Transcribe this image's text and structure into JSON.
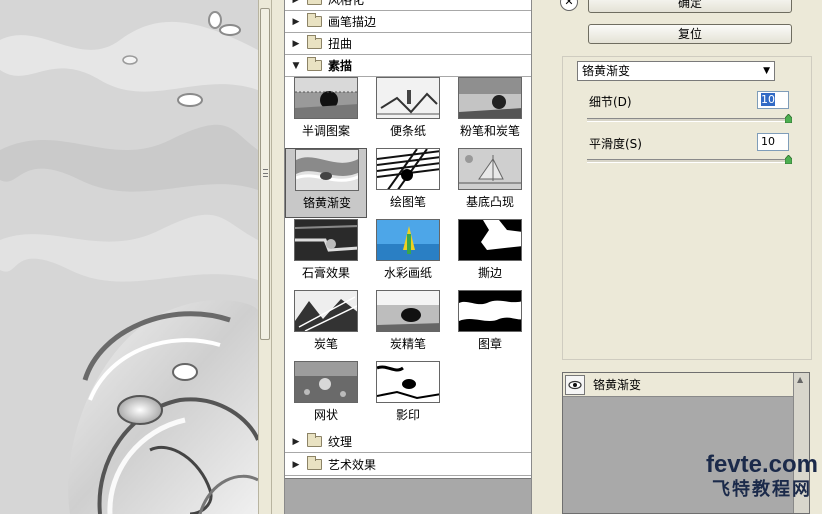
{
  "gallery": {
    "categories_top": [
      {
        "label": "风格化",
        "state": "collapsed"
      },
      {
        "label": "画笔描边",
        "state": "collapsed"
      },
      {
        "label": "扭曲",
        "state": "collapsed"
      },
      {
        "label": "素描",
        "state": "expanded"
      }
    ],
    "filters": [
      {
        "label": "半调图案",
        "selected": false
      },
      {
        "label": "便条纸",
        "selected": false
      },
      {
        "label": "粉笔和炭笔",
        "selected": false
      },
      {
        "label": "铬黄渐变",
        "selected": true
      },
      {
        "label": "绘图笔",
        "selected": false
      },
      {
        "label": "基底凸现",
        "selected": false
      },
      {
        "label": "石膏效果",
        "selected": false
      },
      {
        "label": "水彩画纸",
        "selected": false
      },
      {
        "label": "撕边",
        "selected": false
      },
      {
        "label": "炭笔",
        "selected": false
      },
      {
        "label": "炭精笔",
        "selected": false
      },
      {
        "label": "图章",
        "selected": false
      },
      {
        "label": "网状",
        "selected": false
      },
      {
        "label": "影印",
        "selected": false
      }
    ],
    "categories_bottom": [
      {
        "label": "纹理",
        "state": "collapsed"
      },
      {
        "label": "艺术效果",
        "state": "collapsed"
      }
    ]
  },
  "buttons": {
    "ok_label": "确定",
    "reset_label": "复位"
  },
  "settings": {
    "filter_select": "铬黄渐变",
    "detail_label": "细节(D)",
    "detail_value": "10",
    "smooth_label": "平滑度(S)",
    "smooth_value": "10"
  },
  "layers": {
    "active_layer": "铬黄渐变",
    "visibility_icon": "eye-icon"
  },
  "watermark": {
    "top": "fevte.com",
    "bottom": "飞特教程网"
  },
  "colors": {
    "panel_bg": "#ece9d8",
    "selection_bg": "#c8c8c8",
    "watermark_red": "#c8102e",
    "watermark_navy": "#1b2a4a"
  }
}
